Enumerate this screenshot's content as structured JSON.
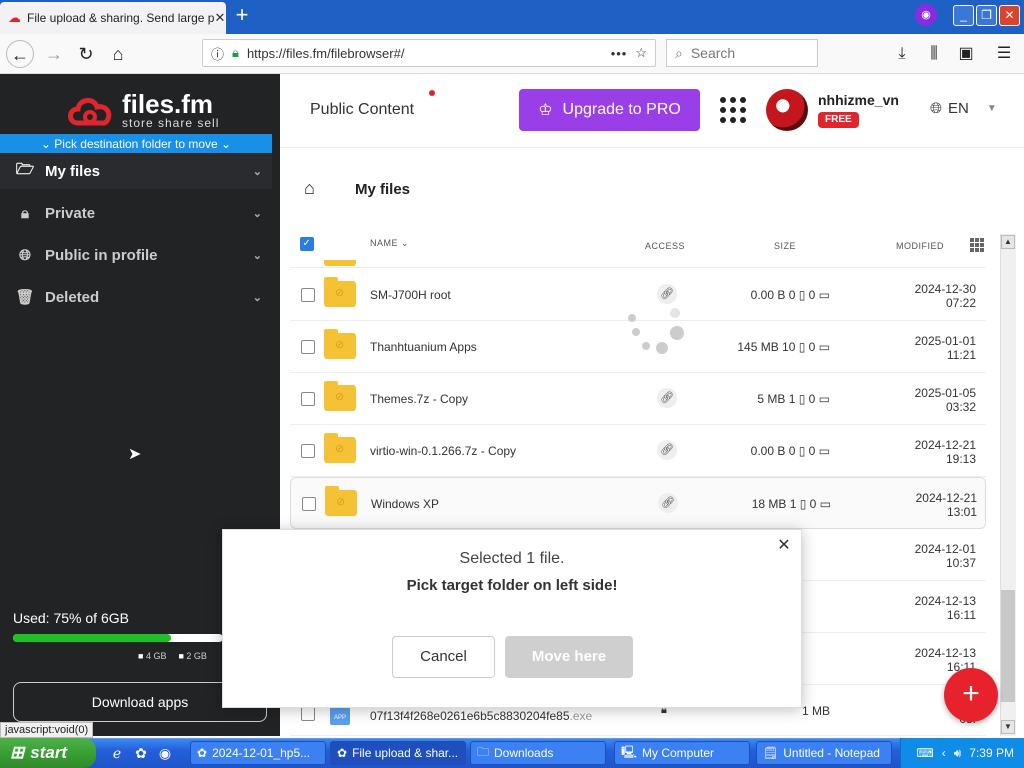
{
  "browser": {
    "tab_title": "File upload & sharing. Send large p",
    "url": "https://files.fm/filebrowser#/",
    "search_placeholder": "Search",
    "status_url": "javascript:void(0)"
  },
  "sidebar": {
    "brand": "files.fm",
    "tagline": "store share sell",
    "pick_banner": "Pick destination folder to move",
    "items": [
      {
        "label": "My files",
        "icon": "folder-open-icon"
      },
      {
        "label": "Private",
        "icon": "lock-icon"
      },
      {
        "label": "Public in profile",
        "icon": "globe-icon"
      },
      {
        "label": "Deleted",
        "icon": "trash-icon"
      }
    ],
    "used_label": "Used: 75% of 6GB",
    "used_fraction": 0.75,
    "legend": [
      "4 GB",
      "2 GB"
    ],
    "download_apps": "Download apps"
  },
  "header": {
    "public_content": "Public Content",
    "upgrade": "Upgrade to PRO",
    "username": "nhhizme_vn",
    "plan_badge": "FREE",
    "language": "EN"
  },
  "breadcrumb": "My files",
  "table": {
    "columns": {
      "name": "NAME",
      "access": "ACCESS",
      "size": "SIZE",
      "modified": "MODIFIED"
    },
    "rows": [
      {
        "name": "SM-J700H root",
        "access": "link",
        "size": "0.00  B 0 ▯ 0 ▭",
        "date": "2024-12-30",
        "time": "07:22"
      },
      {
        "name": "Thanhtuanium Apps",
        "access": "",
        "size": "145 MB 10 ▯ 0 ▭",
        "date": "2025-01-01",
        "time": "11:21"
      },
      {
        "name": "Themes.7z - Copy",
        "access": "link",
        "size": "5 MB 1 ▯ 0 ▭",
        "date": "2025-01-05",
        "time": "03:32"
      },
      {
        "name": "virtio-win-0.1.266.7z - Copy",
        "access": "link",
        "size": "0.00  B 0 ▯ 0 ▭",
        "date": "2024-12-21",
        "time": "19:13"
      },
      {
        "name": "Windows XP",
        "access": "link",
        "size": "18 MB 1 ▯ 0 ▭",
        "date": "2024-12-21",
        "time": "13:01"
      }
    ],
    "hidden_rows": [
      {
        "date": "2024-12-01",
        "time": "10:37"
      },
      {
        "date": "2024-12-13",
        "time": "16:11"
      },
      {
        "date": "2024-12-13",
        "time": "16:11"
      }
    ],
    "last_row": {
      "name": "07f13f4f268e0261e6b5c8830204fe85",
      "ext": ".exe",
      "size": "1 MB",
      "date": "2024",
      "time": "08:"
    }
  },
  "dialog": {
    "title": "Selected 1 file.",
    "subtitle": "Pick target folder on left side!",
    "cancel": "Cancel",
    "move": "Move here"
  },
  "taskbar": {
    "start": "start",
    "tasks": [
      "2024-12-01_hp5...",
      "File upload & shar...",
      "Downloads",
      "My Computer",
      "Untitled - Notepad"
    ],
    "clock": "7:39 PM"
  },
  "colors": {
    "accent_purple": "#9a3fe8",
    "brand_red": "#e0262d",
    "pick_blue": "#1890e8",
    "usage_green": "#1ec028"
  }
}
